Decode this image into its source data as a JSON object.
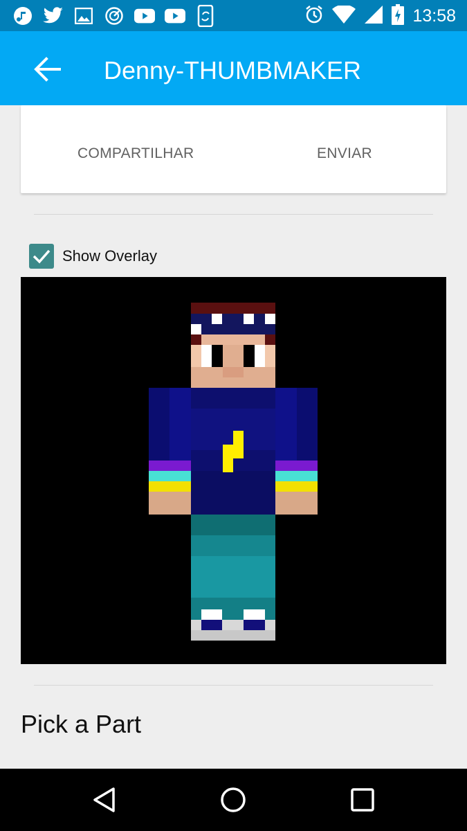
{
  "status_bar": {
    "time": "13:58",
    "left_icons": [
      "music-note-icon",
      "twitter-icon",
      "image-icon",
      "speedometer-icon",
      "youtube-icon",
      "youtube-icon",
      "phone-sync-icon"
    ],
    "right_icons": [
      "alarm-icon",
      "wifi-icon",
      "signal-icon",
      "battery-charging-icon"
    ]
  },
  "app_bar": {
    "title": "Denny-THUMBMAKER",
    "back_icon": "arrow-back-icon",
    "color": "#03a9f4"
  },
  "card": {
    "share_label": "COMPARTILHAR",
    "send_label": "ENVIAR"
  },
  "overlay": {
    "label": "Show Overlay",
    "checked": true,
    "checkbox_color": "#3d8a8a"
  },
  "preview": {
    "background": "#000000",
    "subject": "minecraft-skin-preview"
  },
  "pick_part": {
    "title": "Pick a Part"
  },
  "nav_bar": {
    "icons": [
      "back-triangle-icon",
      "home-circle-icon",
      "recents-square-icon"
    ]
  }
}
